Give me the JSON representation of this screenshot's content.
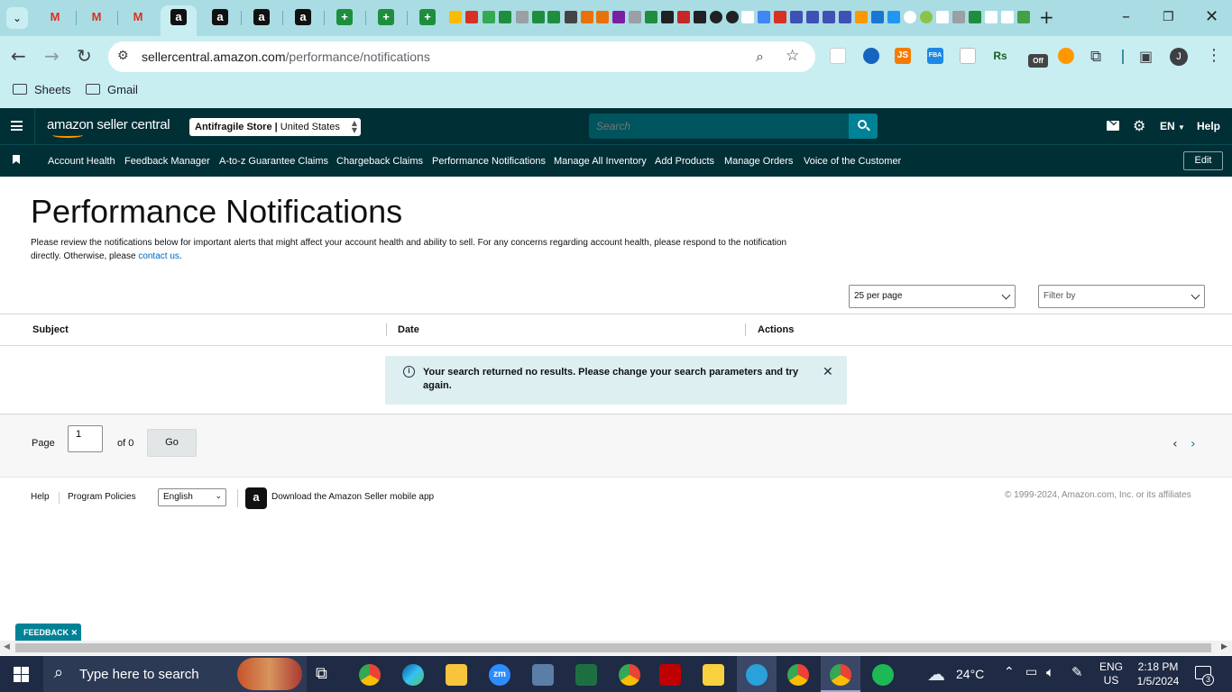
{
  "browser": {
    "url_host": "sellercentral.amazon.com",
    "url_path": "/performance/notifications",
    "bookmarks": [
      "Sheets",
      "Gmail"
    ],
    "profile_initial": "J",
    "ext_js": "JS",
    "ext_fba": "FBA",
    "ext_rs": "Rs",
    "ext_off": "Off"
  },
  "header": {
    "logo_text": "amazon seller central",
    "store": "Antifragile Store",
    "marketplace": "United States",
    "search_placeholder": "Search",
    "language": "EN",
    "help": "Help"
  },
  "nav": {
    "items": [
      "Account Health",
      "Feedback Manager",
      "A-to-z Guarantee Claims",
      "Chargeback Claims",
      "Performance Notifications",
      "Manage All Inventory",
      "Add Products",
      "Manage Orders",
      "Voice of the Customer"
    ],
    "edit": "Edit"
  },
  "page": {
    "title": "Performance Notifications",
    "description": "Please review the notifications below for important alerts that might affect your account health and ability to sell. For any concerns regarding account health, please respond to the notification directly. Otherwise, please",
    "contact_link": "contact us",
    "per_page": "25 per page",
    "filter_placeholder": "Filter by"
  },
  "table": {
    "columns": [
      "Subject",
      "Date",
      "Actions"
    ],
    "empty_message": "Your search returned no results. Please change your search parameters and try again."
  },
  "pager": {
    "label": "Page",
    "value": "1",
    "of": "of 0",
    "go": "Go"
  },
  "footer": {
    "help": "Help",
    "policies": "Program Policies",
    "language": "English",
    "app": "Download the Amazon Seller mobile app",
    "copyright": "© 1999-2024, Amazon.com, Inc. or its affiliates"
  },
  "feedback": "FEEDBACK",
  "taskbar": {
    "search": "Type here to search",
    "temp": "24°C",
    "lang_top": "ENG",
    "lang_bottom": "US",
    "time": "2:18 PM",
    "date": "1/5/2024",
    "notif_count": "3",
    "zoom_label": "zm"
  },
  "colors": {
    "header_bg": "#002f36",
    "accent": "#008296",
    "alert_bg": "#ddeff1",
    "link": "#0066c0"
  }
}
